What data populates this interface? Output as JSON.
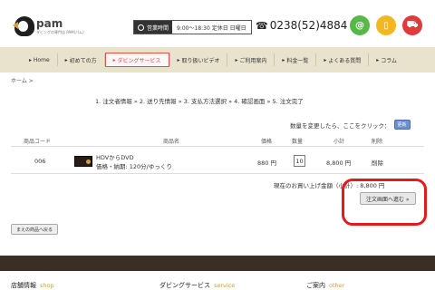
{
  "header": {
    "brand": "pam",
    "brand_sub": "ダビングの専門店 PAM(パム)",
    "hours_label": "営業時間",
    "hours_value": "9:00～18:30 定休日 日曜日",
    "phone": "0238(52)4884",
    "icons": [
      "mail-icon",
      "phone-icon",
      "cart-icon"
    ],
    "accent_colors": {
      "mail": "#58b847",
      "phone": "#f2b824",
      "cart": "#e23a3a"
    }
  },
  "nav": {
    "items": [
      {
        "label": "Home"
      },
      {
        "label": "初めての方"
      },
      {
        "label": "ダビングサービス"
      },
      {
        "label": "取り扱いビデオ"
      },
      {
        "label": "ご利用案内"
      },
      {
        "label": "料金一覧"
      },
      {
        "label": "よくある質問"
      },
      {
        "label": "コラム"
      }
    ]
  },
  "breadcrumb": "ホーム >",
  "steps": "1. 注文者情報 » 2. 送り先情報 » 3. 支払方法選択 » 4. 確認画面 » 5. 注文完了",
  "qty_hint": "数量を変更したら、ここをクリック：",
  "update_label": "更新",
  "table": {
    "headers": [
      "商品コード",
      "商品名",
      "価格",
      "数量",
      "小計",
      "削除"
    ],
    "rows": [
      {
        "code": "006",
        "name": "HDVからDVD",
        "detail": "価格・納期: 120分/ゆっくり",
        "price": "880 円",
        "qty": "10",
        "subtotal": "8,800 円",
        "delete": "削除"
      }
    ]
  },
  "total": "現在のお買い上げ金額（小計）: 8,800 円",
  "proceed_label": "注文画面へ進む »",
  "back_label": "まえの商品へ戻る",
  "footer": {
    "cols": [
      {
        "jp": "店舗情報",
        "en": "shop"
      },
      {
        "jp": "ダビングサービス",
        "en": "service"
      },
      {
        "jp": "ご案内",
        "en": "other"
      }
    ]
  }
}
